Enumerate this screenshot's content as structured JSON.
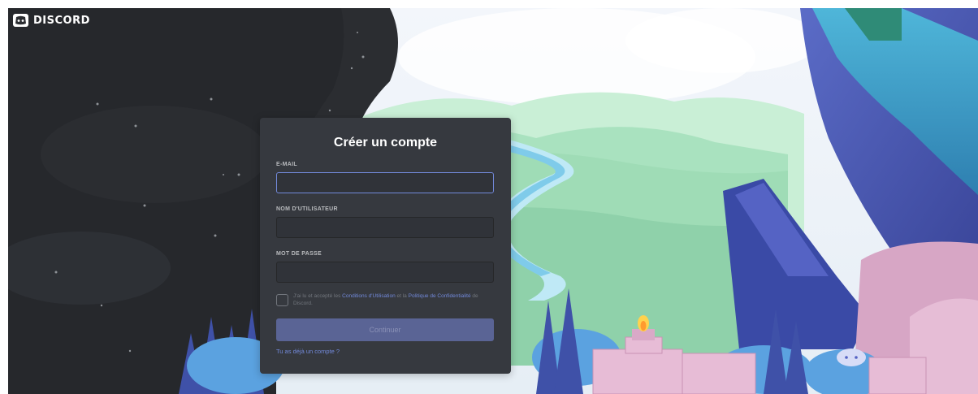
{
  "brand": {
    "name": "DISCORD",
    "logo_icon": "discord-logo-icon"
  },
  "register": {
    "title": "Créer un compte",
    "email": {
      "label": "E-MAIL",
      "value": "",
      "placeholder": ""
    },
    "username": {
      "label": "NOM D'UTILISATEUR",
      "value": "",
      "placeholder": ""
    },
    "password": {
      "label": "MOT DE PASSE",
      "value": "",
      "placeholder": ""
    },
    "tos": {
      "prefix": "J'ai lu et accepté les ",
      "terms_link": "Conditions d'Utilisation",
      "middle": " et la ",
      "privacy_link": "Politique de Confidentialité",
      "suffix": " de Discord."
    },
    "submit_label": "Continuer",
    "login_link": "Tu as déjà un compte ?"
  },
  "colors": {
    "card_bg": "#36393f",
    "accent": "#7289da",
    "button_disabled": "#5a6495",
    "night_sky": "#2c2e33",
    "meadow": "#a4e3b9"
  }
}
